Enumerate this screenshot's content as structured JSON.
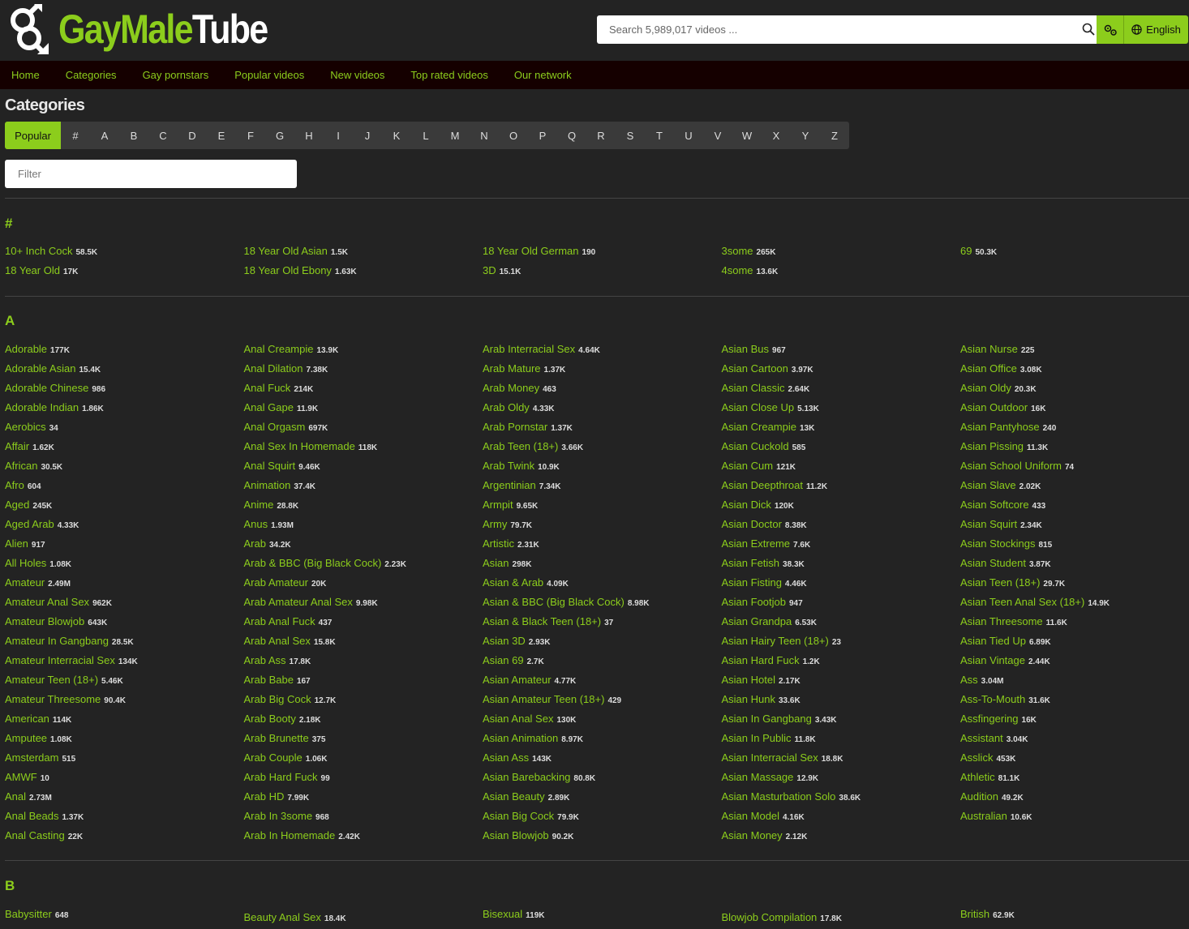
{
  "logo": {
    "part1": "Gay",
    "part2": "Male",
    "part3": "Tube"
  },
  "search": {
    "placeholder": "Search 5,989,017 videos ..."
  },
  "language": {
    "label": "English"
  },
  "nav": [
    "Home",
    "Categories",
    "Gay pornstars",
    "Popular videos",
    "New videos",
    "Top rated videos",
    "Our network"
  ],
  "page_title": "Categories",
  "letters": [
    "Popular",
    "#",
    "A",
    "B",
    "C",
    "D",
    "E",
    "F",
    "G",
    "H",
    "I",
    "J",
    "K",
    "L",
    "M",
    "N",
    "O",
    "P",
    "Q",
    "R",
    "S",
    "T",
    "U",
    "V",
    "W",
    "X",
    "Y",
    "Z"
  ],
  "filter": {
    "placeholder": "Filter"
  },
  "sections": [
    {
      "heading": "#",
      "items": [
        [
          "10+ Inch Cock",
          "58.5K"
        ],
        [
          "18 Year Old",
          "17K"
        ],
        [
          "18 Year Old Asian",
          "1.5K"
        ],
        [
          "18 Year Old Ebony",
          "1.63K"
        ],
        [
          "18 Year Old German",
          "190"
        ],
        [
          "3D",
          "15.1K"
        ],
        [
          "3some",
          "265K"
        ],
        [
          "4some",
          "13.6K"
        ],
        [
          "69",
          "50.3K"
        ]
      ]
    },
    {
      "heading": "A",
      "items": [
        [
          "Adorable",
          "177K"
        ],
        [
          "Adorable Asian",
          "15.4K"
        ],
        [
          "Adorable Chinese",
          "986"
        ],
        [
          "Adorable Indian",
          "1.86K"
        ],
        [
          "Aerobics",
          "34"
        ],
        [
          "Affair",
          "1.62K"
        ],
        [
          "African",
          "30.5K"
        ],
        [
          "Afro",
          "604"
        ],
        [
          "Aged",
          "245K"
        ],
        [
          "Aged Arab",
          "4.33K"
        ],
        [
          "Alien",
          "917"
        ],
        [
          "All Holes",
          "1.08K"
        ],
        [
          "Amateur",
          "2.49M"
        ],
        [
          "Amateur Anal Sex",
          "962K"
        ],
        [
          "Amateur Blowjob",
          "643K"
        ],
        [
          "Amateur In Gangbang",
          "28.5K"
        ],
        [
          "Amateur Interracial Sex",
          "134K"
        ],
        [
          "Amateur Teen (18+)",
          "5.46K"
        ],
        [
          "Amateur Threesome",
          "90.4K"
        ],
        [
          "American",
          "114K"
        ],
        [
          "Amputee",
          "1.08K"
        ],
        [
          "Amsterdam",
          "515"
        ],
        [
          "AMWF",
          "10"
        ],
        [
          "Anal",
          "2.73M"
        ],
        [
          "Anal Beads",
          "1.37K"
        ],
        [
          "Anal Casting",
          "22K"
        ],
        [
          "Anal Creampie",
          "13.9K"
        ],
        [
          "Anal Dilation",
          "7.38K"
        ],
        [
          "Anal Fuck",
          "214K"
        ],
        [
          "Anal Gape",
          "11.9K"
        ],
        [
          "Anal Orgasm",
          "697K"
        ],
        [
          "Anal Sex In Homemade",
          "118K"
        ],
        [
          "Anal Squirt",
          "9.46K"
        ],
        [
          "Animation",
          "37.4K"
        ],
        [
          "Anime",
          "28.8K"
        ],
        [
          "Anus",
          "1.93M"
        ],
        [
          "Arab",
          "34.2K"
        ],
        [
          "Arab & BBC (Big Black Cock)",
          "2.23K"
        ],
        [
          "Arab Amateur",
          "20K"
        ],
        [
          "Arab Amateur Anal Sex",
          "9.98K"
        ],
        [
          "Arab Anal Fuck",
          "437"
        ],
        [
          "Arab Anal Sex",
          "15.8K"
        ],
        [
          "Arab Ass",
          "17.8K"
        ],
        [
          "Arab Babe",
          "167"
        ],
        [
          "Arab Big Cock",
          "12.7K"
        ],
        [
          "Arab Booty",
          "2.18K"
        ],
        [
          "Arab Brunette",
          "375"
        ],
        [
          "Arab Couple",
          "1.06K"
        ],
        [
          "Arab Hard Fuck",
          "99"
        ],
        [
          "Arab HD",
          "7.99K"
        ],
        [
          "Arab In 3some",
          "968"
        ],
        [
          "Arab In Homemade",
          "2.42K"
        ],
        [
          "Arab Interracial Sex",
          "4.64K"
        ],
        [
          "Arab Mature",
          "1.37K"
        ],
        [
          "Arab Money",
          "463"
        ],
        [
          "Arab Oldy",
          "4.33K"
        ],
        [
          "Arab Pornstar",
          "1.37K"
        ],
        [
          "Arab Teen (18+)",
          "3.66K"
        ],
        [
          "Arab Twink",
          "10.9K"
        ],
        [
          "Argentinian",
          "7.34K"
        ],
        [
          "Armpit",
          "9.65K"
        ],
        [
          "Army",
          "79.7K"
        ],
        [
          "Artistic",
          "2.31K"
        ],
        [
          "Asian",
          "298K"
        ],
        [
          "Asian & Arab",
          "4.09K"
        ],
        [
          "Asian & BBC (Big Black Cock)",
          "8.98K"
        ],
        [
          "Asian & Black Teen (18+)",
          "37"
        ],
        [
          "Asian 3D",
          "2.93K"
        ],
        [
          "Asian 69",
          "2.7K"
        ],
        [
          "Asian Amateur",
          "4.77K"
        ],
        [
          "Asian Amateur Teen (18+)",
          "429"
        ],
        [
          "Asian Anal Sex",
          "130K"
        ],
        [
          "Asian Animation",
          "8.97K"
        ],
        [
          "Asian Ass",
          "143K"
        ],
        [
          "Asian Barebacking",
          "80.8K"
        ],
        [
          "Asian Beauty",
          "2.89K"
        ],
        [
          "Asian Big Cock",
          "79.9K"
        ],
        [
          "Asian Blowjob",
          "90.2K"
        ],
        [
          "Asian Bus",
          "967"
        ],
        [
          "Asian Cartoon",
          "3.97K"
        ],
        [
          "Asian Classic",
          "2.64K"
        ],
        [
          "Asian Close Up",
          "5.13K"
        ],
        [
          "Asian Creampie",
          "13K"
        ],
        [
          "Asian Cuckold",
          "585"
        ],
        [
          "Asian Cum",
          "121K"
        ],
        [
          "Asian Deepthroat",
          "11.2K"
        ],
        [
          "Asian Dick",
          "120K"
        ],
        [
          "Asian Doctor",
          "8.38K"
        ],
        [
          "Asian Extreme",
          "7.6K"
        ],
        [
          "Asian Fetish",
          "38.3K"
        ],
        [
          "Asian Fisting",
          "4.46K"
        ],
        [
          "Asian Footjob",
          "947"
        ],
        [
          "Asian Grandpa",
          "6.53K"
        ],
        [
          "Asian Hairy Teen (18+)",
          "23"
        ],
        [
          "Asian Hard Fuck",
          "1.2K"
        ],
        [
          "Asian Hotel",
          "2.17K"
        ],
        [
          "Asian Hunk",
          "33.6K"
        ],
        [
          "Asian In Gangbang",
          "3.43K"
        ],
        [
          "Asian In Public",
          "11.8K"
        ],
        [
          "Asian Interracial Sex",
          "18.8K"
        ],
        [
          "Asian Massage",
          "12.9K"
        ],
        [
          "Asian Masturbation Solo",
          "38.6K"
        ],
        [
          "Asian Model",
          "4.16K"
        ],
        [
          "Asian Money",
          "2.12K"
        ],
        [
          "Asian Nurse",
          "225"
        ],
        [
          "Asian Office",
          "3.08K"
        ],
        [
          "Asian Oldy",
          "20.3K"
        ],
        [
          "Asian Outdoor",
          "16K"
        ],
        [
          "Asian Pantyhose",
          "240"
        ],
        [
          "Asian Pissing",
          "11.3K"
        ],
        [
          "Asian School Uniform",
          "74"
        ],
        [
          "Asian Slave",
          "2.02K"
        ],
        [
          "Asian Softcore",
          "433"
        ],
        [
          "Asian Squirt",
          "2.34K"
        ],
        [
          "Asian Stockings",
          "815"
        ],
        [
          "Asian Student",
          "3.87K"
        ],
        [
          "Asian Teen (18+)",
          "29.7K"
        ],
        [
          "Asian Teen Anal Sex (18+)",
          "14.9K"
        ],
        [
          "Asian Threesome",
          "11.6K"
        ],
        [
          "Asian Tied Up",
          "6.89K"
        ],
        [
          "Asian Vintage",
          "2.44K"
        ],
        [
          "Ass",
          "3.04M"
        ],
        [
          "Ass-To-Mouth",
          "31.6K"
        ],
        [
          "Assfingering",
          "16K"
        ],
        [
          "Assistant",
          "3.04K"
        ],
        [
          "Asslick",
          "453K"
        ],
        [
          "Athletic",
          "81.1K"
        ],
        [
          "Audition",
          "49.2K"
        ],
        [
          "Australian",
          "10.6K"
        ]
      ]
    },
    {
      "heading": "B",
      "items": [
        [
          "Babysitter",
          "648"
        ],
        [
          "Beauty Anal Sex",
          "18.4K"
        ],
        [
          "Bisexual",
          "119K"
        ],
        [
          "Blowjob Compilation",
          "17.8K"
        ],
        [
          "British",
          "62.9K"
        ]
      ]
    }
  ]
}
